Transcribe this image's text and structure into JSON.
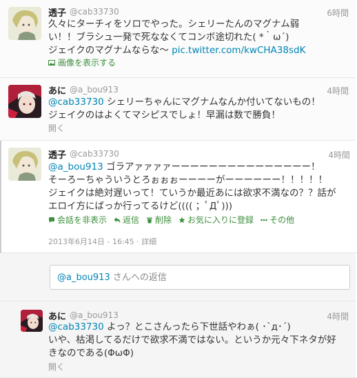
{
  "tweets": [
    {
      "name": "透子",
      "handle": "@cab33730",
      "time": "6時間",
      "lines": [
        "久々にターチィをソロでやった。シェリーたんのマグナム弱",
        "い！！ブラシュ一発で死ななくてコンボ途切れた( *｀ω´)",
        "ジェイクのマグナムならな〜 "
      ],
      "link": "pic.twitter.com/kwCHA38sdK",
      "media_label": "画像を表示する"
    },
    {
      "name": "あに",
      "handle": "@a_bou913",
      "time": "4時間",
      "mention": "@cab33730",
      "lines": [
        " シェリーちゃんにマグナムなんか付いてないもの！",
        "ジェイクのはよくてマシピスでしょ！早漏は数で勝負！"
      ],
      "expand": "開く"
    },
    {
      "name": "透子",
      "handle": "@cab33730",
      "time": "4時間",
      "mention": "@a_bou913",
      "lines": [
        " ゴラアァァァァーーーーーーーーーーーーーーー！",
        "そーろーちゃういうとろぉぉぉーーーーがーーーーーー！！！！！",
        "ジェイクは絶対遅いって！ていうか最近あには欲求不満なの？？話が",
        "エロイ方にばっか行ってるけど(((( ；ﾟДﾟ)))"
      ],
      "actions": {
        "hide_conversation": "会話を非表示",
        "reply": "返信",
        "delete": "削除",
        "favorite": "お気に入りに登録",
        "more": "その他"
      },
      "timestamp": "2013年6月14日 - 16:45",
      "details": "詳細"
    },
    {
      "name": "あに",
      "handle": "@a_bou913",
      "time": "4時間",
      "mention": "@cab33730",
      "lines": [
        " よっ？とこさんったら下世話やわぁ( ･`д･´)",
        "いや、枯渇してるだけで欲求不満ではない。というか元々下ネタが好",
        "きなのである(ΦωΦ)"
      ],
      "expand": "開く"
    }
  ],
  "reply_box": {
    "mention": "@a_bou913",
    "suffix": " さんへの返信"
  },
  "colors": {
    "link": "#0084b4",
    "action_green": "#3c8f3c"
  }
}
